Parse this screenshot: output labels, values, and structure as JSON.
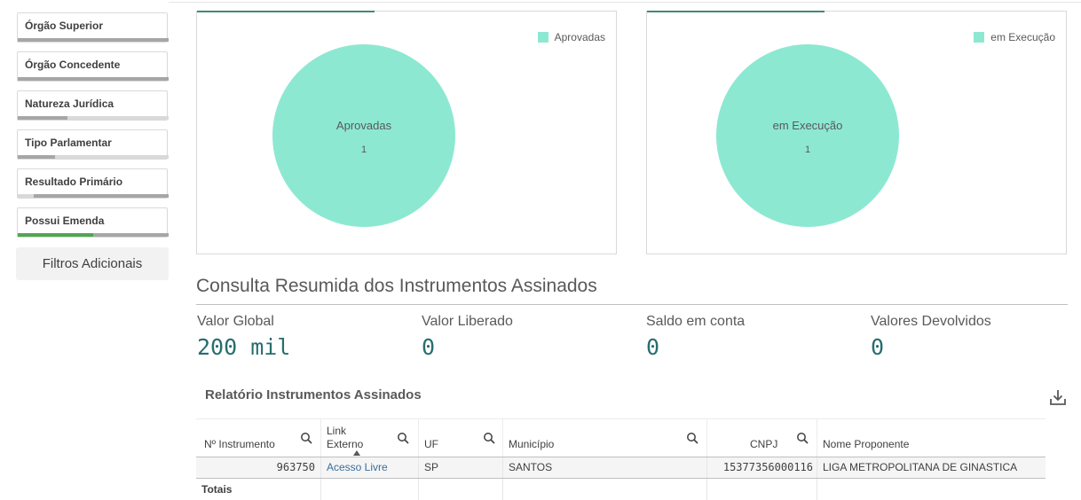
{
  "sidebar": {
    "filters": [
      {
        "label": "Órgão Superior",
        "fill_fraction": 0
      },
      {
        "label": "Órgão Concedente",
        "fill_fraction": 0
      },
      {
        "label": "Natureza Jurídica",
        "fill_fraction": 0
      },
      {
        "label": "Tipo Parlamentar",
        "fill_fraction": 0
      },
      {
        "label": "Resultado Primário",
        "fill_fraction": 0
      },
      {
        "label": "Possui Emenda",
        "fill_fraction": 0.5
      }
    ],
    "more_filters_label": "Filtros Adicionais"
  },
  "charts": [
    {
      "legend": "Aprovadas",
      "slice_label": "Aprovadas",
      "slice_value": "1",
      "color": "#8de8d2"
    },
    {
      "legend": "em Execução",
      "slice_label": "em Execução",
      "slice_value": "1",
      "color": "#8de8d2"
    }
  ],
  "chart_data": [
    {
      "type": "pie",
      "categories": [
        "Aprovadas"
      ],
      "values": [
        1
      ],
      "legend_position": "top-right"
    },
    {
      "type": "pie",
      "categories": [
        "em Execução"
      ],
      "values": [
        1
      ],
      "legend_position": "top-right"
    }
  ],
  "section": {
    "title": "Consulta Resumida dos Instrumentos Assinados",
    "kpis": [
      {
        "label": "Valor Global",
        "value": "200 mil"
      },
      {
        "label": "Valor Liberado",
        "value": "0"
      },
      {
        "label": "Saldo em conta",
        "value": "0"
      },
      {
        "label": "Valores Devolvidos",
        "value": "0"
      }
    ]
  },
  "report": {
    "title": "Relatório Instrumentos Assinados",
    "columns": [
      "Nº Instrumento",
      "Link Externo",
      "UF",
      "Município",
      "CNPJ",
      "Nome Proponente"
    ],
    "rows": [
      [
        "963750",
        "Acesso Livre",
        "SP",
        "SANTOS",
        "15377356000116",
        "LIGA METROPOLITANA DE GINASTICA"
      ]
    ],
    "totals_label": "Totais"
  },
  "colors": {
    "accent": "#276e6e",
    "pie": "#8de8d2",
    "link": "#3a6e9e",
    "selected_bar": "#52a552"
  }
}
